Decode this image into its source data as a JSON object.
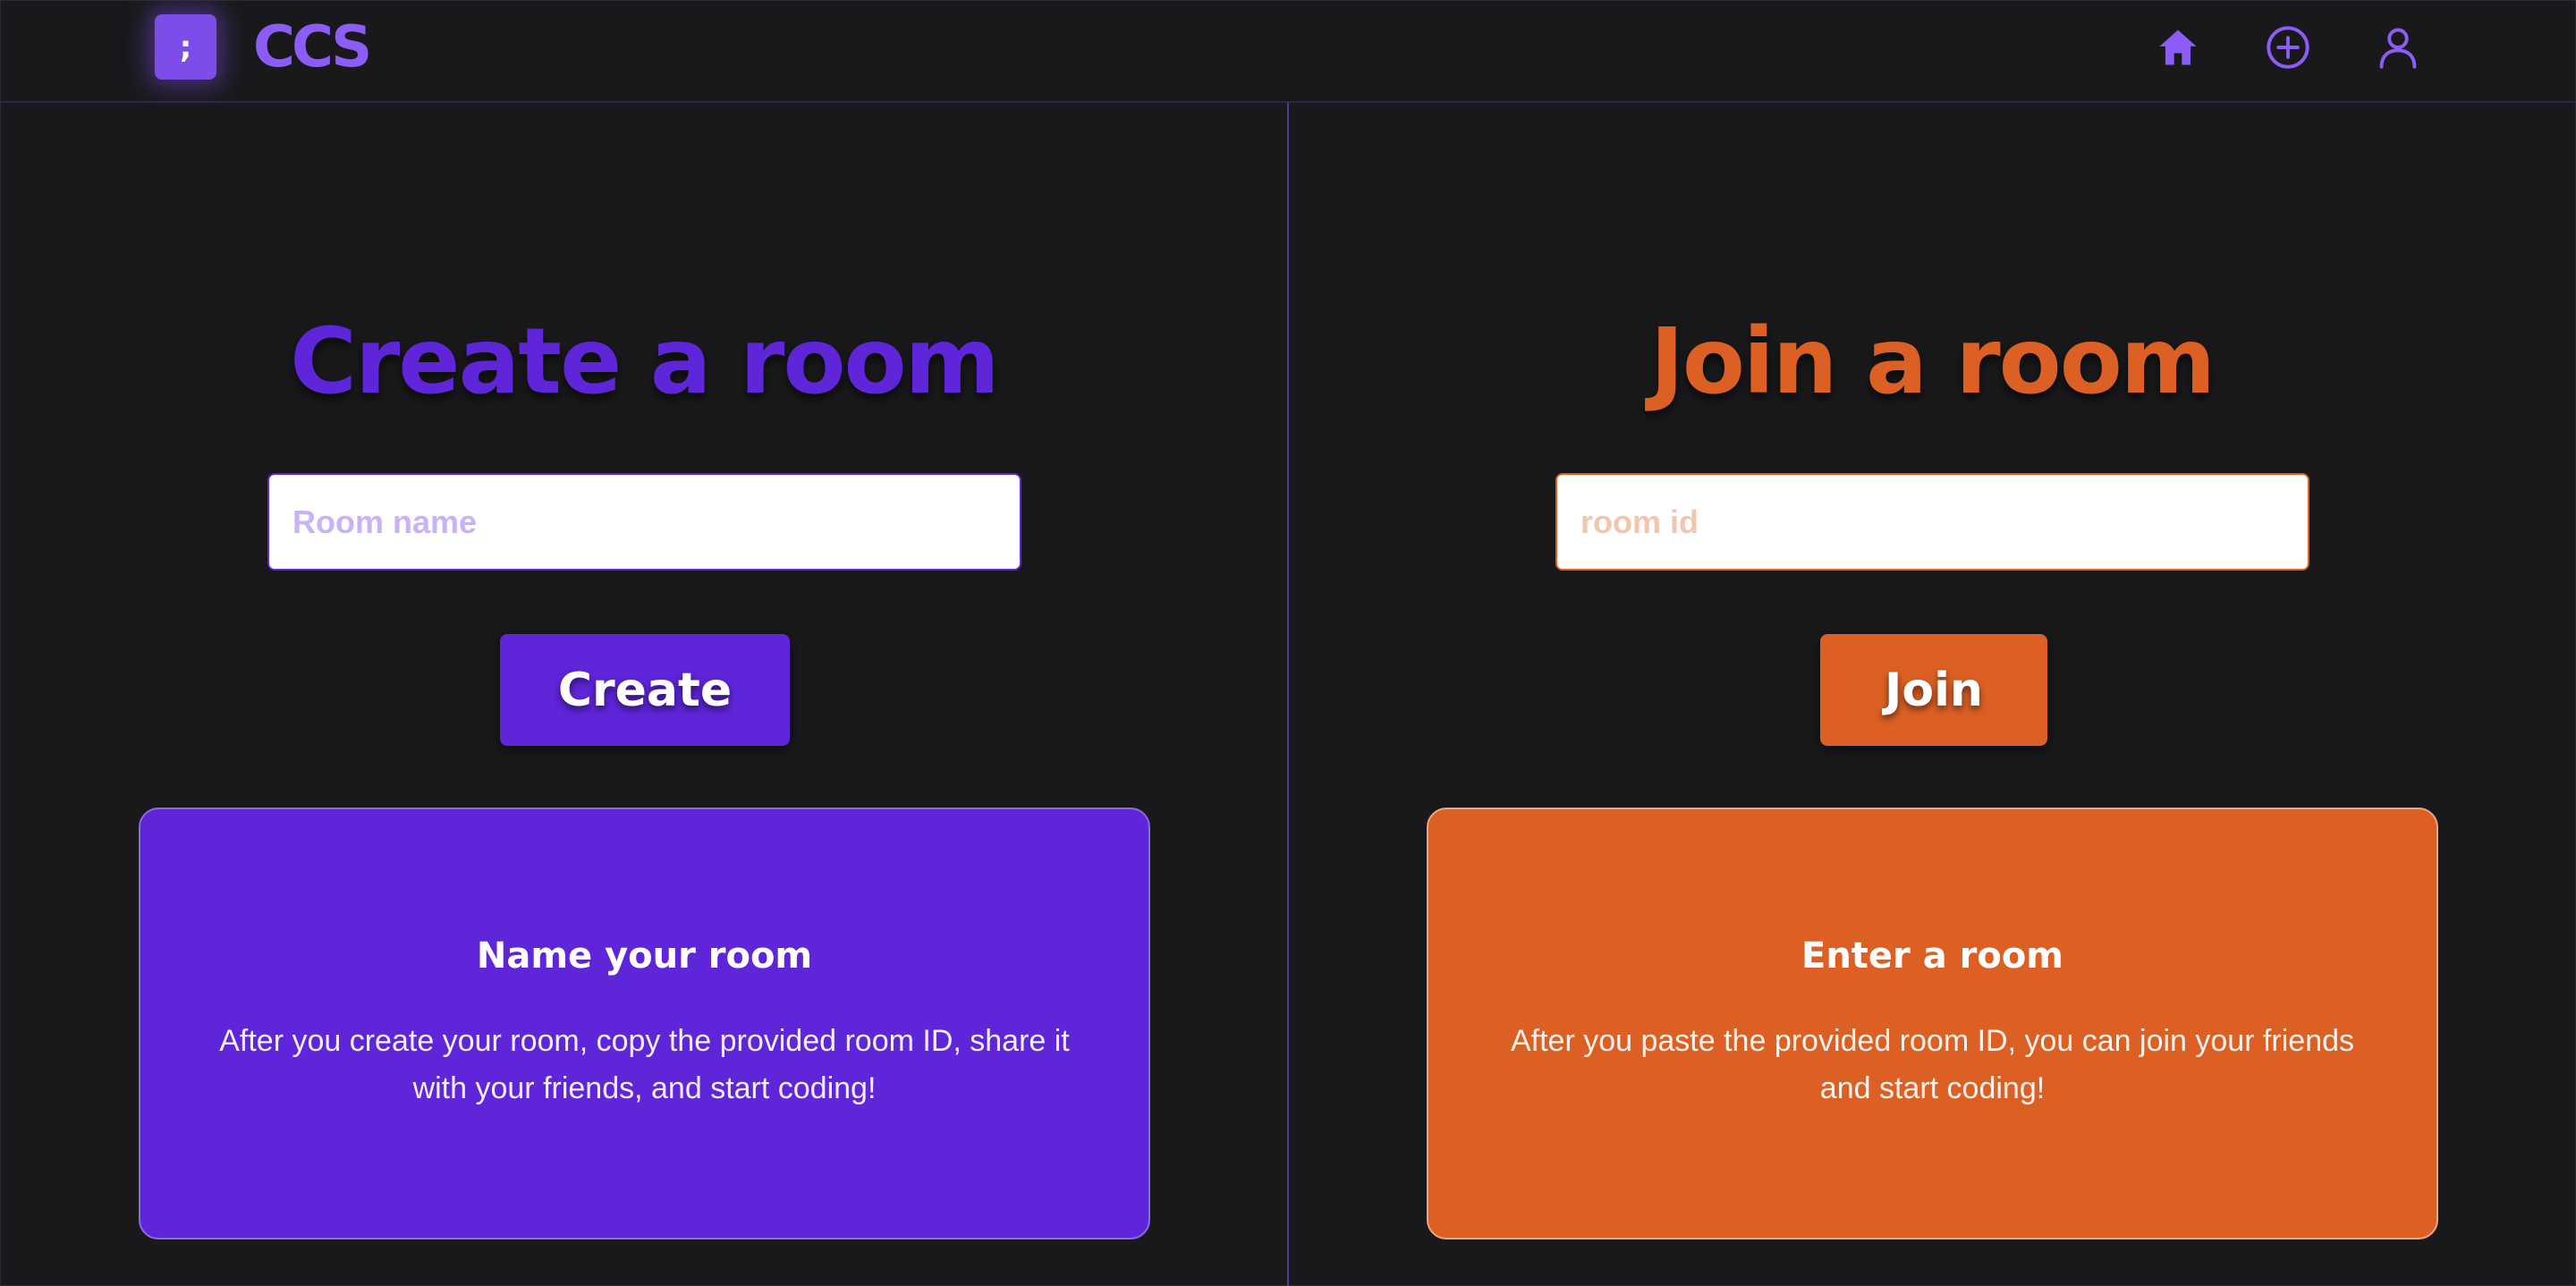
{
  "header": {
    "logo_glyph": ";",
    "brand": "CCS",
    "nav": [
      {
        "icon": "home-icon"
      },
      {
        "icon": "plus-circle-icon"
      },
      {
        "icon": "user-icon"
      }
    ],
    "accent_color": "#8b5cf6"
  },
  "create": {
    "title": "Create a room",
    "input_placeholder": "Room name",
    "input_value": "",
    "button_label": "Create",
    "card_title": "Name your room",
    "card_text": "After you create your room, copy the provided room ID, share it with your friends, and start coding!",
    "color": "#5e25d9"
  },
  "join": {
    "title": "Join a room",
    "input_placeholder": "room id",
    "input_value": "",
    "button_label": "Join",
    "card_title": "Enter a room",
    "card_text": "After you paste the provided room ID, you can join your friends and start coding!",
    "color": "#dc6024"
  }
}
